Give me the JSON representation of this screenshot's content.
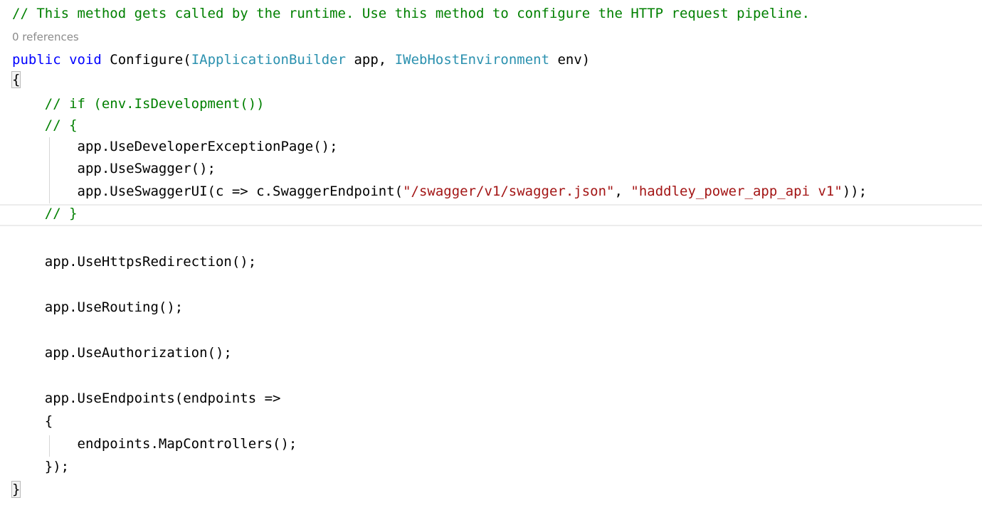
{
  "editor": {
    "colors": {
      "comment": "#008000",
      "keyword": "#0000ff",
      "type": "#2b91af",
      "string": "#a31515",
      "plain": "#000000",
      "codelens": "#8b8b8b"
    },
    "codelens": "0 references",
    "lines": [
      {
        "tokens": [
          {
            "text": "// This method gets called by the runtime. Use this method to configure the HTTP request pipeline.",
            "kind": "comment"
          }
        ]
      },
      {
        "tokens": [
          {
            "text": "public",
            "kind": "keyword"
          },
          {
            "text": " ",
            "kind": "plain"
          },
          {
            "text": "void",
            "kind": "keyword"
          },
          {
            "text": " Configure(",
            "kind": "plain"
          },
          {
            "text": "IApplicationBuilder",
            "kind": "type"
          },
          {
            "text": " app, ",
            "kind": "plain"
          },
          {
            "text": "IWebHostEnvironment",
            "kind": "type"
          },
          {
            "text": " env)",
            "kind": "plain"
          }
        ]
      },
      {
        "tokens": [
          {
            "text": "{",
            "kind": "plain",
            "match": true
          }
        ]
      },
      {
        "tokens": [
          {
            "text": "    ",
            "kind": "plain"
          },
          {
            "text": "// if (env.IsDevelopment())",
            "kind": "comment"
          }
        ]
      },
      {
        "tokens": [
          {
            "text": "    ",
            "kind": "plain"
          },
          {
            "text": "// {",
            "kind": "comment"
          }
        ]
      },
      {
        "tokens": [
          {
            "text": "        app.UseDeveloperExceptionPage();",
            "kind": "plain"
          }
        ]
      },
      {
        "tokens": [
          {
            "text": "        app.UseSwagger();",
            "kind": "plain"
          }
        ]
      },
      {
        "tokens": [
          {
            "text": "        app.UseSwaggerUI(c => c.SwaggerEndpoint(",
            "kind": "plain"
          },
          {
            "text": "\"/swagger/v1/swagger.json\"",
            "kind": "string"
          },
          {
            "text": ", ",
            "kind": "plain"
          },
          {
            "text": "\"haddley_power_app_api v1\"",
            "kind": "string"
          },
          {
            "text": "));",
            "kind": "plain"
          }
        ]
      },
      {
        "tokens": [
          {
            "text": "    ",
            "kind": "plain"
          },
          {
            "text": "// }",
            "kind": "comment"
          }
        ]
      },
      {
        "tokens": []
      },
      {
        "tokens": [
          {
            "text": "    app.UseHttpsRedirection();",
            "kind": "plain"
          }
        ]
      },
      {
        "tokens": []
      },
      {
        "tokens": [
          {
            "text": "    app.UseRouting();",
            "kind": "plain"
          }
        ]
      },
      {
        "tokens": []
      },
      {
        "tokens": [
          {
            "text": "    app.UseAuthorization();",
            "kind": "plain"
          }
        ]
      },
      {
        "tokens": []
      },
      {
        "tokens": [
          {
            "text": "    app.UseEndpoints(endpoints =>",
            "kind": "plain"
          }
        ]
      },
      {
        "tokens": [
          {
            "text": "    {",
            "kind": "plain"
          }
        ]
      },
      {
        "tokens": [
          {
            "text": "        endpoints.MapControllers();",
            "kind": "plain"
          }
        ]
      },
      {
        "tokens": [
          {
            "text": "    });",
            "kind": "plain"
          }
        ]
      },
      {
        "tokens": [
          {
            "text": "}",
            "kind": "plain",
            "match": true
          }
        ]
      }
    ]
  }
}
